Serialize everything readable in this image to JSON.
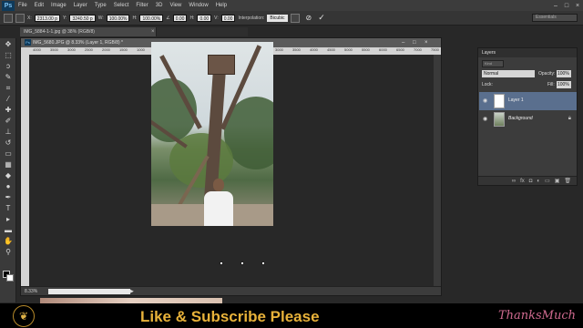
{
  "app": {
    "logo": "Ps"
  },
  "menu": [
    "File",
    "Edit",
    "Image",
    "Layer",
    "Type",
    "Select",
    "Filter",
    "3D",
    "View",
    "Window",
    "Help"
  ],
  "window_controls": [
    "–",
    "□",
    "×"
  ],
  "options": {
    "x_label": "X:",
    "x_value": "2313.00 p",
    "y_label": "Y:",
    "y_value": "3240.50 p",
    "w_label": "W:",
    "w_value": "100.00%",
    "h_label": "H:",
    "h_value": "100.00%",
    "angle_value": "0.00",
    "hskew_label": "H:",
    "hskew_value": "0.00",
    "vskew_label": "V:",
    "vskew_value": "0.00",
    "interp_label": "Interpolation:",
    "interp_value": "Bicubic",
    "workspace": "Essentials"
  },
  "tabs": [
    {
      "label": "IMG_5884-1-1.jpg @ 38% (RGB/8)"
    },
    {
      "label": "IMG_5680.JPG @ 8.33% (Layer 1, RGB/8) *"
    }
  ],
  "document": {
    "title": "IMG_5680.JPG @ 8.33% (Layer 1, RGB/8) *",
    "zoom": "8.33%",
    "ruler_ticks": [
      "4000",
      "3500",
      "3000",
      "2500",
      "2000",
      "1500",
      "1000",
      "500",
      "0",
      "500",
      "1000",
      "1500",
      "2000",
      "2500",
      "3000",
      "3500",
      "4000",
      "4500",
      "5000",
      "5500",
      "6000",
      "6500",
      "7000",
      "7500"
    ]
  },
  "layers_panel": {
    "title": "Layers",
    "kind": "Kind",
    "blend_mode": "Normal",
    "opacity_label": "Opacity:",
    "opacity_value": "100%",
    "lock_label": "Lock:",
    "fill_label": "Fill:",
    "fill_value": "100%",
    "layers": [
      {
        "name": "Layer 1",
        "selected": true
      },
      {
        "name": "Background",
        "selected": false,
        "locked": true
      }
    ]
  },
  "banner": {
    "text": "Like & Subscribe Please",
    "signature": "ThanksMuch",
    "colors": {
      "text": "#e8b23a",
      "signature": "#cf6a8f"
    }
  }
}
